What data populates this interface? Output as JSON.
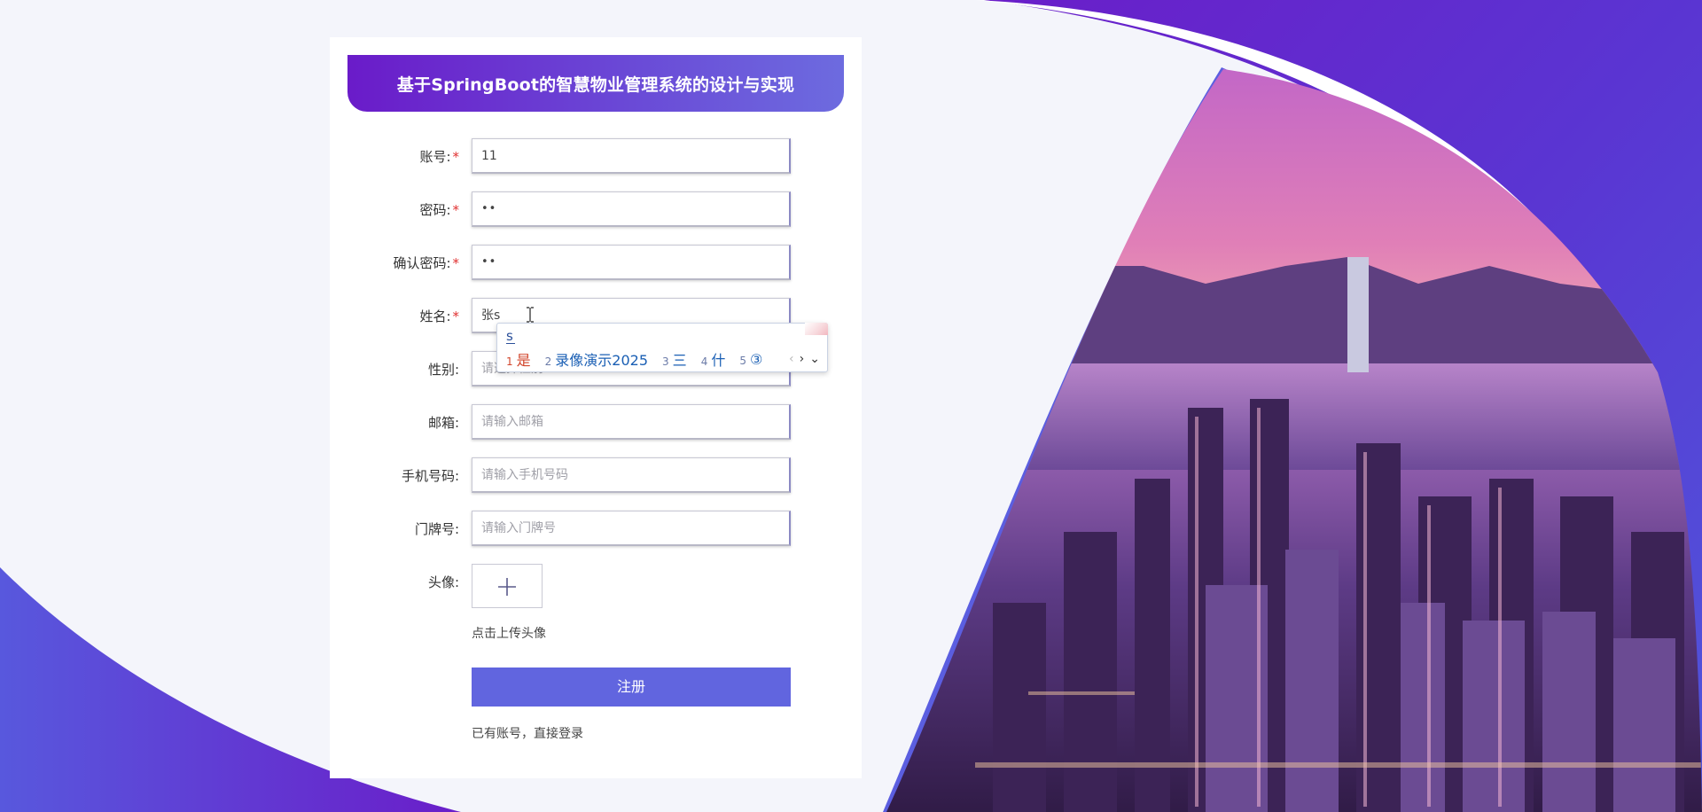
{
  "app": {
    "title": "基于SpringBoot的智慧物业管理系统的设计与实现"
  },
  "form": {
    "fields": {
      "account": {
        "label": "账号:",
        "required": true,
        "value": "11"
      },
      "password": {
        "label": "密码:",
        "required": true,
        "value": "••"
      },
      "confirm": {
        "label": "确认密码:",
        "required": true,
        "value": "••"
      },
      "name": {
        "label": "姓名:",
        "required": true,
        "value": "张s"
      },
      "gender": {
        "label": "性别:",
        "required": false,
        "placeholder": "请选择性别"
      },
      "email": {
        "label": "邮箱:",
        "required": false,
        "placeholder": "请输入邮箱"
      },
      "phone": {
        "label": "手机号码:",
        "required": false,
        "placeholder": "请输入手机号码"
      },
      "door": {
        "label": "门牌号:",
        "required": false,
        "placeholder": "请输入门牌号"
      }
    },
    "avatar": {
      "label": "头像:",
      "hint": "点击上传头像",
      "icon": "plus-icon"
    },
    "required_mark": "*",
    "submit_label": "注册",
    "login_link": "已有账号，直接登录"
  },
  "ime": {
    "composition": "s",
    "candidates": [
      {
        "num": "1",
        "text": "是"
      },
      {
        "num": "2",
        "text": "录像演示2025"
      },
      {
        "num": "3",
        "text": "三"
      },
      {
        "num": "4",
        "text": "什"
      },
      {
        "num": "5",
        "text": "③"
      }
    ],
    "nav": {
      "prev": "‹",
      "next": "›",
      "expand": "⌄"
    }
  },
  "colors": {
    "accent": "#6165df",
    "header_start": "#6a1bc9",
    "header_end": "#6d6bdf",
    "wave": "#5b2bd0",
    "required": "#e03030"
  }
}
